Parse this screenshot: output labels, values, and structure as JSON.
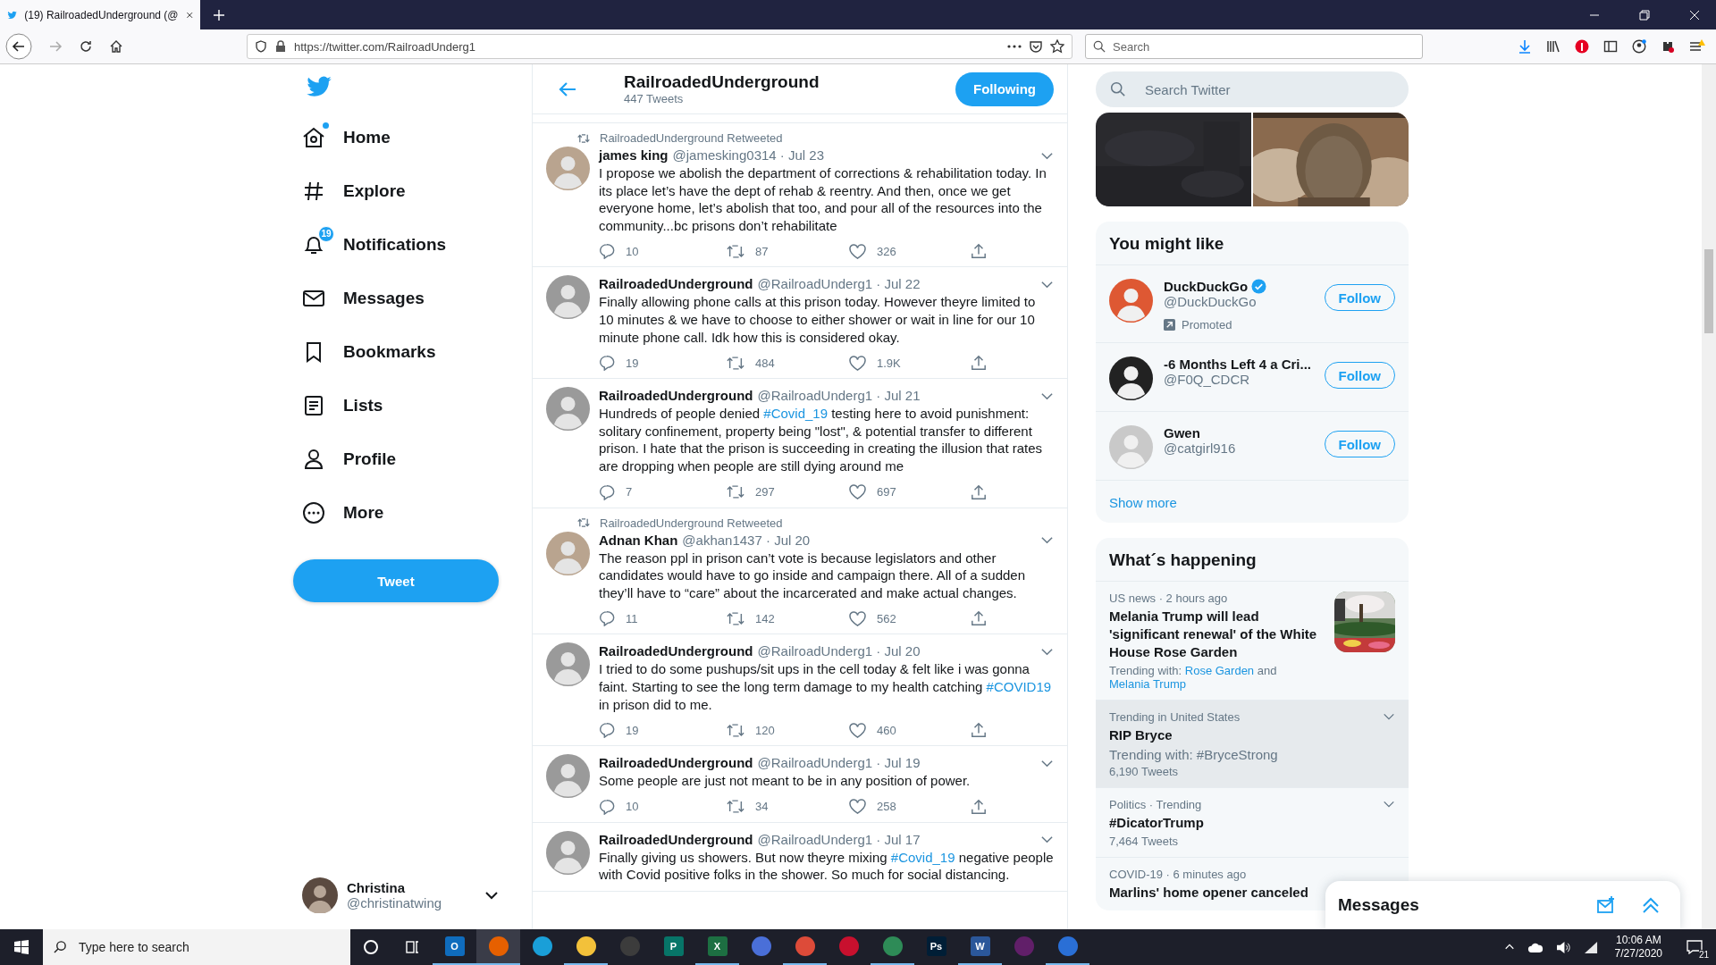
{
  "browser": {
    "tab_title": "(19) RailroadedUnderground (@",
    "url": "https://twitter.com/RailroadUnderg1",
    "search": {
      "placeholder": "Search"
    }
  },
  "sidebar": {
    "items": [
      {
        "label": "Home",
        "dot": true
      },
      {
        "label": "Explore"
      },
      {
        "label": "Notifications",
        "badge": "19"
      },
      {
        "label": "Messages"
      },
      {
        "label": "Bookmarks"
      },
      {
        "label": "Lists"
      },
      {
        "label": "Profile"
      },
      {
        "label": "More"
      }
    ],
    "tweet_button": "Tweet",
    "account": {
      "name": "Christina",
      "handle": "@christinatwing"
    }
  },
  "header": {
    "title": "RailroadedUnderground",
    "subtitle": "447 Tweets",
    "button": "Following"
  },
  "tweets": [
    {
      "retweeted_by": "RailroadedUnderground Retweeted",
      "name": "james king",
      "meta": "@jamesking0314 · Jul 23",
      "body": [
        {
          "text": "I propose we abolish the department of corrections & rehabilitation today. In its place let’s have the dept of rehab & reentry. And then, once we get everyone home, let’s abolish that too, and pour all of the resources into the community...bc prisons don’t rehabilitate",
          "link": false
        }
      ],
      "replies": "10",
      "retweets": "87",
      "likes": "326"
    },
    {
      "name": "RailroadedUnderground",
      "meta": "@RailroadUnderg1 · Jul 22",
      "body": [
        {
          "text": "Finally allowing phone calls at this prison today. However theyre limited to 10 minutes & we have to choose to either shower or wait in line for our 10 minute phone call. Idk how this is considered okay.",
          "link": false
        }
      ],
      "replies": "19",
      "retweets": "484",
      "likes": "1.9K"
    },
    {
      "name": "RailroadedUnderground",
      "meta": "@RailroadUnderg1 · Jul 21",
      "body": [
        {
          "text": "Hundreds of people denied ",
          "link": false
        },
        {
          "text": "#Covid_19",
          "link": true
        },
        {
          "text": " testing here to avoid punishment: solitary confinement, property being \"lost\", & potential transfer to different prison. I hate that the prison is succeeding in creating the illusion that rates are dropping when people are still dying around me",
          "link": false
        }
      ],
      "replies": "7",
      "retweets": "297",
      "likes": "697"
    },
    {
      "retweeted_by": "RailroadedUnderground Retweeted",
      "name": "Adnan Khan",
      "meta": "@akhan1437 · Jul 20",
      "body": [
        {
          "text": "The reason ppl in prison can’t vote is because legislators and other candidates would have to go inside and campaign there. All of a sudden they’ll have to “care” about the incarcerated and make actual changes.",
          "link": false
        }
      ],
      "replies": "11",
      "retweets": "142",
      "likes": "562"
    },
    {
      "name": "RailroadedUnderground",
      "meta": "@RailroadUnderg1 · Jul 20",
      "body": [
        {
          "text": "I tried to do some pushups/sit ups in the cell today & felt like i was gonna faint. Starting to see the long term damage to my health catching ",
          "link": false
        },
        {
          "text": "#COVID19",
          "link": true
        },
        {
          "text": " in prison did to me.",
          "link": false
        }
      ],
      "replies": "19",
      "retweets": "120",
      "likes": "460"
    },
    {
      "name": "RailroadedUnderground",
      "meta": "@RailroadUnderg1 · Jul 19",
      "body": [
        {
          "text": "Some people are just not meant to be in any position of power.",
          "link": false
        }
      ],
      "replies": "10",
      "retweets": "34",
      "likes": "258"
    },
    {
      "name": "RailroadedUnderground",
      "meta": "@RailroadUnderg1 · Jul 17",
      "body": [
        {
          "text": "Finally giving us showers. But now theyre mixing ",
          "link": false
        },
        {
          "text": "#Covid_19",
          "link": true
        },
        {
          "text": " negative people with Covid positive folks in the shower. So much for social distancing.",
          "link": false
        }
      ]
    }
  ],
  "search": {
    "placeholder": "Search Twitter"
  },
  "who_to_follow": {
    "title": "You might like",
    "users": [
      {
        "name": "DuckDuckGo",
        "handle": "@DuckDuckGo",
        "verified": true,
        "promoted": "Promoted",
        "button": "Follow"
      },
      {
        "name": "-6 Months Left 4 a Cri...",
        "handle": "@F0Q_CDCR",
        "verified": false,
        "button": "Follow"
      },
      {
        "name": "Gwen",
        "handle": "@catgirl916",
        "verified": false,
        "button": "Follow"
      }
    ],
    "show_more": "Show more"
  },
  "trends": {
    "title": "What´s happening",
    "items": [
      {
        "kind": "picture",
        "meta": "US news · 2 hours ago",
        "title": "Melania Trump will lead 'significant renewal' of the White House Rose Garden",
        "context": [
          {
            "text": "Trending with: ",
            "link": false
          },
          {
            "text": "Rose Garden",
            "link": true
          },
          {
            "text": " and ",
            "link": false
          },
          {
            "text": "Melania Trump",
            "link": true
          }
        ],
        "highlighted": false
      },
      {
        "kind": "menu",
        "meta": "Trending in United States",
        "title": "RIP Bryce",
        "context": [
          {
            "text": "Trending with: #BryceStrong",
            "link": false
          }
        ],
        "count": "6,190 Tweets",
        "highlighted": true
      },
      {
        "kind": "menu",
        "meta": "Politics · Trending",
        "title": "#DicatorTrump",
        "count": "7,464 Tweets",
        "highlighted": false
      },
      {
        "kind": "plain",
        "meta": "COVID-19 · 6 minutes ago",
        "title": "Marlins' home opener canceled",
        "highlighted": false
      }
    ]
  },
  "messages_drawer": {
    "title": "Messages"
  },
  "taskbar": {
    "search_placeholder": "Type here to search",
    "apps": [
      {
        "label": "O",
        "running": true,
        "active": false
      },
      {
        "running": true,
        "active": true
      },
      {
        "running": false,
        "active": false
      },
      {
        "running": true,
        "active": false
      },
      {
        "running": false,
        "active": false
      },
      {
        "label": "P",
        "running": false,
        "active": false
      },
      {
        "label": "X",
        "running": true,
        "active": false
      },
      {
        "running": false,
        "active": false
      },
      {
        "running": true,
        "active": false
      },
      {
        "running": false,
        "active": false
      },
      {
        "running": true,
        "active": false
      },
      {
        "label": "Ps",
        "running": false,
        "active": false
      },
      {
        "label": "W",
        "running": true,
        "active": false
      },
      {
        "running": false,
        "active": false
      },
      {
        "running": true,
        "active": false
      }
    ],
    "time": "10:06 AM",
    "date": "7/27/2020",
    "notifications": "21"
  }
}
